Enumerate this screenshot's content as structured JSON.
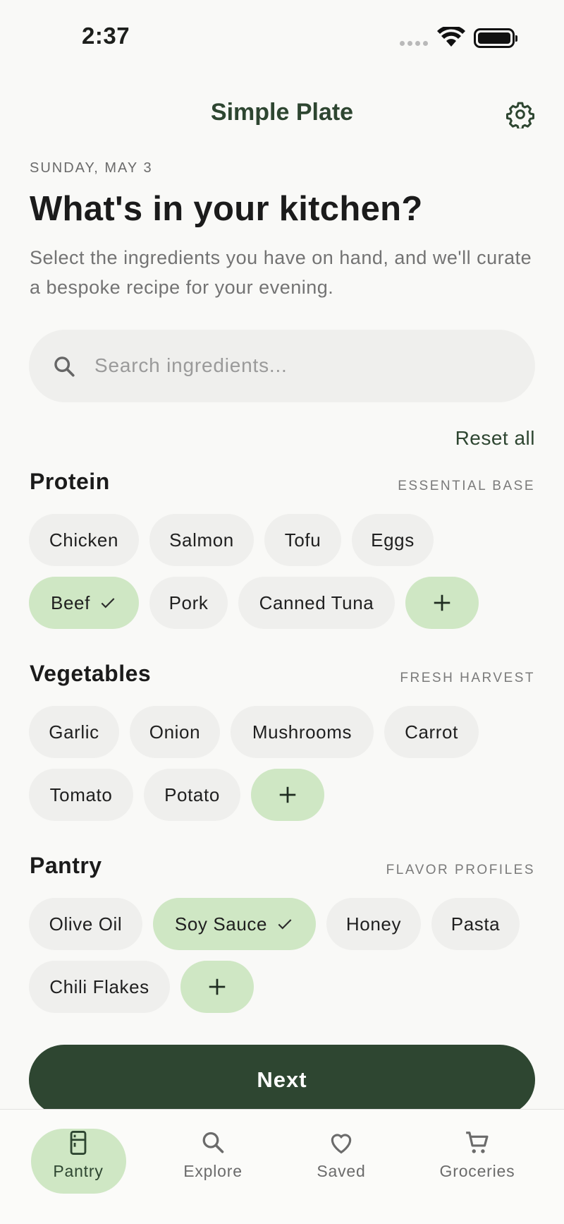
{
  "status_bar": {
    "time": "2:37"
  },
  "header": {
    "title": "Simple Plate",
    "settings_icon": "gear-icon"
  },
  "intro": {
    "date": "SUNDAY, MAY 3",
    "heading": "What's in your kitchen?",
    "subtitle": "Select the ingredients you have on hand, and we'll curate a bespoke recipe for your evening."
  },
  "search": {
    "placeholder": "Search ingredients...",
    "value": ""
  },
  "reset_label": "Reset all",
  "sections": [
    {
      "title": "Protein",
      "tag": "ESSENTIAL BASE",
      "items": [
        {
          "label": "Chicken",
          "selected": false
        },
        {
          "label": "Salmon",
          "selected": false
        },
        {
          "label": "Tofu",
          "selected": false
        },
        {
          "label": "Eggs",
          "selected": false
        },
        {
          "label": "Beef",
          "selected": true
        },
        {
          "label": "Pork",
          "selected": false
        },
        {
          "label": "Canned Tuna",
          "selected": false
        }
      ]
    },
    {
      "title": "Vegetables",
      "tag": "FRESH HARVEST",
      "items": [
        {
          "label": "Garlic",
          "selected": false
        },
        {
          "label": "Onion",
          "selected": false
        },
        {
          "label": "Mushrooms",
          "selected": false
        },
        {
          "label": "Carrot",
          "selected": false
        },
        {
          "label": "Tomato",
          "selected": false
        },
        {
          "label": "Potato",
          "selected": false
        }
      ]
    },
    {
      "title": "Pantry",
      "tag": "FLAVOR PROFILES",
      "items": [
        {
          "label": "Olive Oil",
          "selected": false
        },
        {
          "label": "Soy Sauce",
          "selected": true
        },
        {
          "label": "Honey",
          "selected": false
        },
        {
          "label": "Pasta",
          "selected": false
        },
        {
          "label": "Chili Flakes",
          "selected": false
        }
      ]
    }
  ],
  "next_label": "Next",
  "nav": [
    {
      "label": "Pantry",
      "icon": "fridge-icon",
      "active": true
    },
    {
      "label": "Explore",
      "icon": "search-icon",
      "active": false
    },
    {
      "label": "Saved",
      "icon": "heart-icon",
      "active": false
    },
    {
      "label": "Groceries",
      "icon": "cart-icon",
      "active": false
    }
  ],
  "colors": {
    "primary": "#2e4631",
    "selected_chip": "#cfe7c4",
    "chip": "#efefed",
    "background": "#f9f9f7"
  }
}
